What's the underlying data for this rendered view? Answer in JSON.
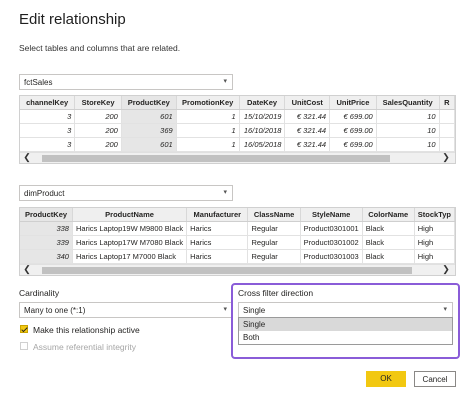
{
  "dialog": {
    "title": "Edit relationship",
    "subtitle": "Select tables and columns that are related."
  },
  "table1": {
    "name": "fctSales",
    "columns": [
      "channelKey",
      "StoreKey",
      "ProductKey",
      "PromotionKey",
      "DateKey",
      "UnitCost",
      "UnitPrice",
      "SalesQuantity",
      "R"
    ],
    "rows": [
      [
        "3",
        "200",
        "601",
        "1",
        "15/10/2019",
        "€ 321.44",
        "€ 699.00",
        "10",
        ""
      ],
      [
        "3",
        "200",
        "369",
        "1",
        "16/10/2018",
        "€ 321.44",
        "€ 699.00",
        "10",
        ""
      ],
      [
        "3",
        "200",
        "601",
        "1",
        "16/05/2018",
        "€ 321.44",
        "€ 699.00",
        "10",
        ""
      ]
    ]
  },
  "table2": {
    "name": "dimProduct",
    "columns": [
      "ProductKey",
      "ProductName",
      "Manufacturer",
      "ClassName",
      "StyleName",
      "ColorName",
      "StockTyp"
    ],
    "rows": [
      [
        "338",
        "Harics Laptop19W M9800 Black",
        "Harics",
        "Regular",
        "Product0301001",
        "Black",
        "High"
      ],
      [
        "339",
        "Harics Laptop17W M7080 Black",
        "Harics",
        "Regular",
        "Product0301002",
        "Black",
        "High"
      ],
      [
        "340",
        "Harics Laptop17 M7000 Black",
        "Harics",
        "Regular",
        "Product0301003",
        "Black",
        "High"
      ]
    ]
  },
  "cardinality": {
    "label": "Cardinality",
    "value": "Many to one (*:1)"
  },
  "cross_filter": {
    "label": "Cross filter direction",
    "value": "Single",
    "options": [
      "Single",
      "Both"
    ]
  },
  "options": {
    "make_active": "Make this relationship active",
    "make_active_checked": true,
    "referential": "Assume referential integrity",
    "referential_checked": false
  },
  "buttons": {
    "ok": "OK",
    "cancel": "Cancel"
  },
  "colors": {
    "accent": "#f2c811",
    "highlight": "#8a5cd8"
  }
}
